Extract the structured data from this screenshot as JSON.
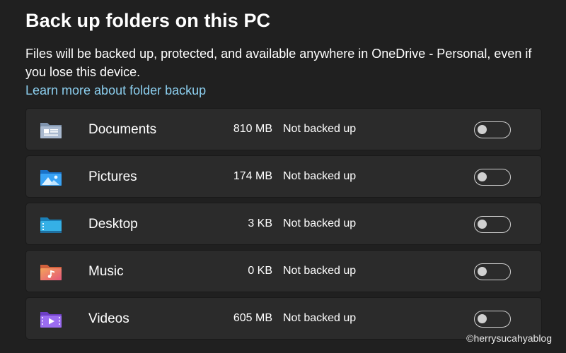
{
  "page": {
    "title": "Back up folders on this PC",
    "description": "Files will be backed up, protected, and available anywhere in OneDrive - Personal, even if you lose this device.",
    "learn_more_link": "Learn more about folder backup"
  },
  "folders": [
    {
      "name": "Documents",
      "size": "810 MB",
      "status": "Not backed up",
      "icon": "documents-folder-icon",
      "backup_enabled": false
    },
    {
      "name": "Pictures",
      "size": "174 MB",
      "status": "Not backed up",
      "icon": "pictures-folder-icon",
      "backup_enabled": false
    },
    {
      "name": "Desktop",
      "size": "3 KB",
      "status": "Not backed up",
      "icon": "desktop-folder-icon",
      "backup_enabled": false
    },
    {
      "name": "Music",
      "size": "0 KB",
      "status": "Not backed up",
      "icon": "music-folder-icon",
      "backup_enabled": false
    },
    {
      "name": "Videos",
      "size": "605 MB",
      "status": "Not backed up",
      "icon": "videos-folder-icon",
      "backup_enabled": false
    }
  ],
  "watermark": "©herrysucahyablog",
  "colors": {
    "background": "#202020",
    "row_background": "#2b2b2b",
    "link": "#8ccfef",
    "toggle_off": "#d0d0d0"
  }
}
